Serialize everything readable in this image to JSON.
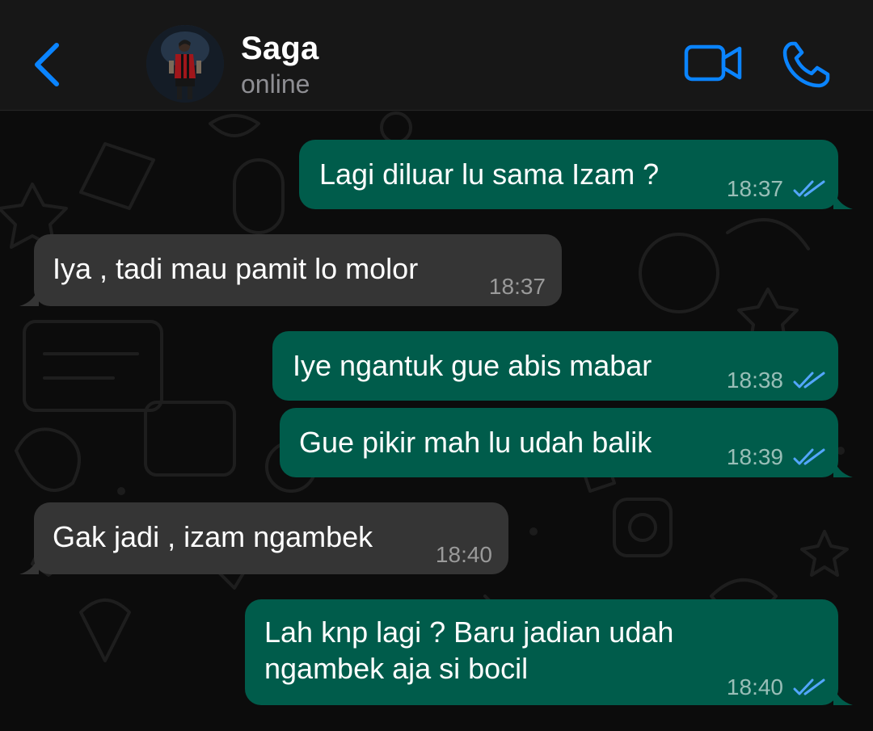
{
  "header": {
    "contact_name": "Saga",
    "status": "online",
    "back_icon": "chevron-left-icon",
    "video_icon": "video-camera-icon",
    "call_icon": "phone-icon"
  },
  "colors": {
    "accent": "#0a84ff",
    "outgoing_bubble": "#005c4b",
    "incoming_bubble": "#353535",
    "read_ticks": "#53a6ff"
  },
  "messages": [
    {
      "direction": "out",
      "text": "Lagi diluar lu sama Izam ?",
      "time": "18:37",
      "status": "read"
    },
    {
      "direction": "in",
      "text": "Iya , tadi mau pamit lo molor",
      "time": "18:37"
    },
    {
      "direction": "out",
      "text": "Iye ngantuk gue abis mabar",
      "time": "18:38",
      "status": "read"
    },
    {
      "direction": "out",
      "text": "Gue pikir mah lu udah balik",
      "time": "18:39",
      "status": "read"
    },
    {
      "direction": "in",
      "text": "Gak jadi , izam ngambek",
      "time": "18:40"
    },
    {
      "direction": "out",
      "text_lines": [
        "Lah knp lagi ? Baru jadian udah",
        "ngambek aja si bocil"
      ],
      "time": "18:40",
      "status": "read"
    }
  ]
}
